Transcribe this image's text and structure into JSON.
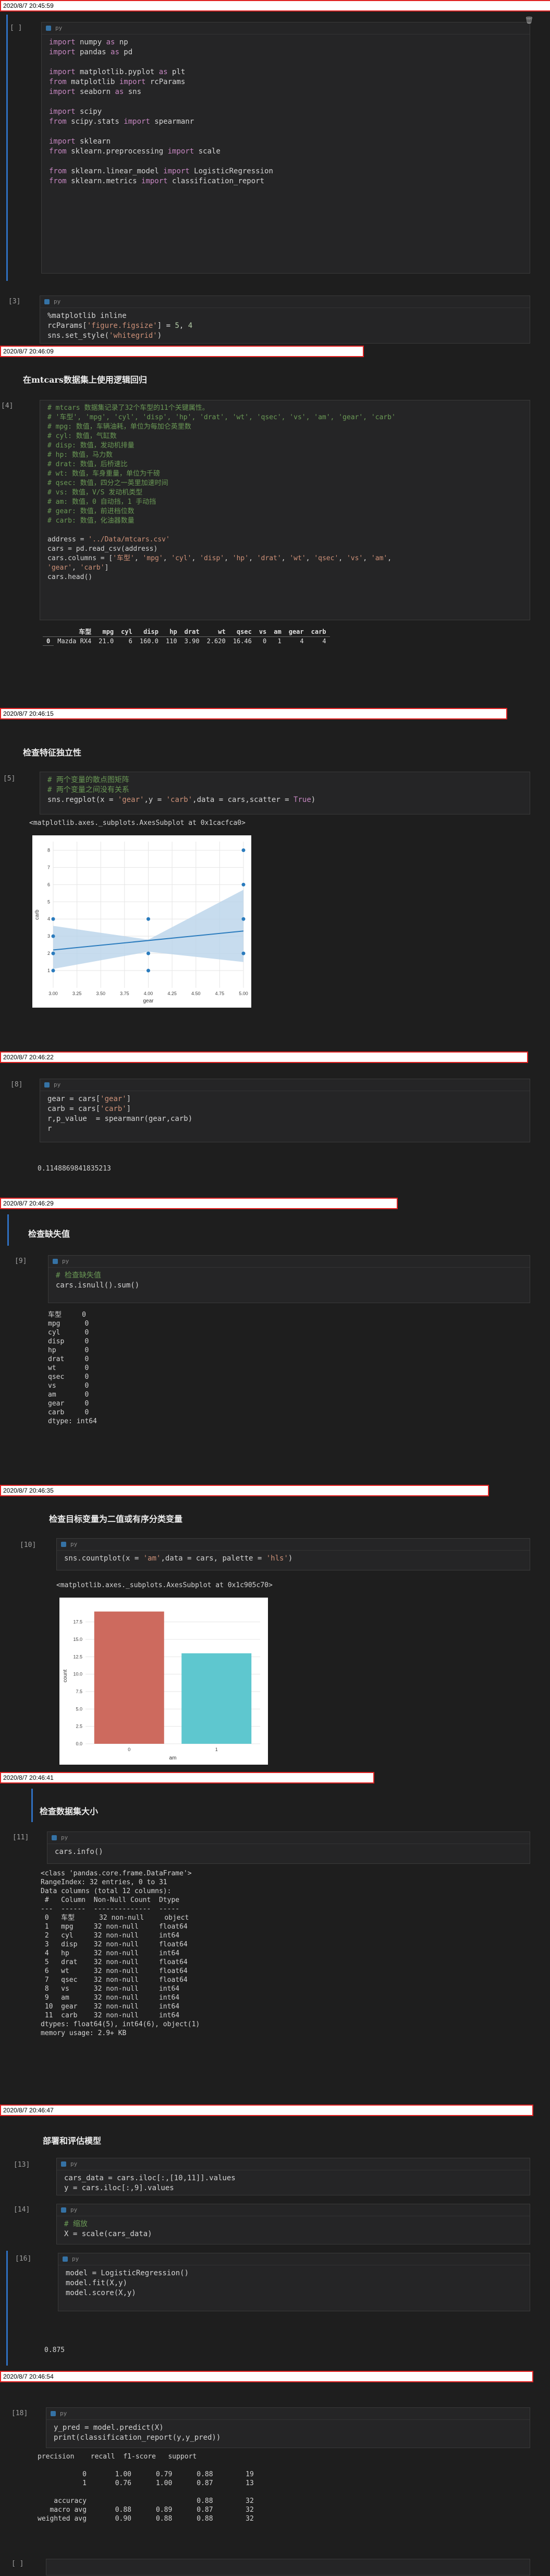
{
  "timestamps": [
    "2020/8/7 20:45:59",
    "2020/8/7 20:46:09",
    "2020/8/7 20:46:15",
    "2020/8/7 20:46:22",
    "2020/8/7 20:46:29",
    "2020/8/7 20:46:35",
    "2020/8/7 20:46:41",
    "2020/8/7 20:46:47",
    "2020/8/7 20:46:54"
  ],
  "editor_lang": "py",
  "cells": {
    "c1": {
      "prompt": "[ ]"
    },
    "c3": {
      "prompt": "[3]"
    },
    "c4": {
      "prompt": "[4]"
    },
    "c5": {
      "prompt": "[5]",
      "output": "<matplotlib.axes._subplots.AxesSubplot at 0x1cacfca0>"
    },
    "c8": {
      "prompt": "[8]",
      "output": "0.1148869841835213"
    },
    "c9": {
      "prompt": "[9]"
    },
    "c10": {
      "prompt": "[10]",
      "output": "<matplotlib.axes._subplots.AxesSubplot at 0x1c905c70>"
    },
    "c11": {
      "prompt": "[11]"
    },
    "c13": {
      "prompt": "[13]"
    },
    "c14": {
      "prompt": "[14]"
    },
    "c16": {
      "prompt": "[16]",
      "output": "0.875"
    },
    "c18": {
      "prompt": "[18]"
    },
    "c_empty": {
      "prompt": "[ ]"
    }
  },
  "headings": {
    "h1": "在mtcars数据集上使用逻辑回归",
    "h2": "检查特征独立性",
    "h3": "检查缺失值",
    "h4": "检查目标变量为二值或有序分类变量",
    "h5": "检查数据集大小",
    "h6": "部署和评估模型"
  },
  "head_table": {
    "columns": [
      "车型",
      "mpg",
      "cyl",
      "disp",
      "hp",
      "drat",
      "wt",
      "qsec",
      "vs",
      "am",
      "gear",
      "carb"
    ],
    "rows": [
      [
        "0",
        "Mazda RX4",
        "21.0",
        "6",
        "160.0",
        "110",
        "3.90",
        "2.620",
        "16.46",
        "0",
        "1",
        "4",
        "4"
      ]
    ]
  },
  "isnull_output": "车型     0\nmpg      0\ncyl      0\ndisp     0\nhp       0\ndrat     0\nwt       0\nqsec     0\nvs       0\nam       0\ngear     0\ncarb     0\ndtype: int64",
  "info_output": "<class 'pandas.core.frame.DataFrame'>\nRangeIndex: 32 entries, 0 to 31\nData columns (total 12 columns):\n #   Column  Non-Null Count  Dtype  \n---  ------  --------------  -----  \n 0   车型      32 non-null     object \n 1   mpg     32 non-null     float64\n 2   cyl     32 non-null     int64  \n 3   disp    32 non-null     float64\n 4   hp      32 non-null     int64  \n 5   drat    32 non-null     float64\n 6   wt      32 non-null     float64\n 7   qsec    32 non-null     float64\n 8   vs      32 non-null     int64  \n 9   am      32 non-null     int64  \n 10  gear    32 non-null     int64  \n 11  carb    32 non-null     int64  \ndtypes: float64(5), int64(6), object(1)\nmemory usage: 2.9+ KB",
  "report_output": "precision    recall  f1-score   support\n\n           0       1.00      0.79      0.88        19\n           1       0.76      1.00      0.87        13\n\n    accuracy                           0.88        32\n   macro avg       0.88      0.89      0.87        32\nweighted avg       0.90      0.88      0.88        32",
  "chart_data": [
    {
      "type": "scatter",
      "xlabel": "gear",
      "ylabel": "carb",
      "xlim": [
        3.0,
        5.0
      ],
      "ylim": [
        0,
        8.5
      ],
      "x_ticks": [
        "3.00",
        "3.25",
        "3.50",
        "3.75",
        "4.00",
        "4.25",
        "4.50",
        "4.75",
        "5.00"
      ],
      "y_ticks": [
        "8",
        "7",
        "6",
        "5",
        "4",
        "3",
        "2",
        "1"
      ],
      "points": [
        [
          3,
          1
        ],
        [
          3,
          2
        ],
        [
          3,
          3
        ],
        [
          3,
          4
        ],
        [
          4,
          1
        ],
        [
          4,
          2
        ],
        [
          4,
          4
        ],
        [
          5,
          2
        ],
        [
          5,
          4
        ],
        [
          5,
          6
        ],
        [
          5,
          8
        ]
      ],
      "fit_line": [
        [
          3,
          2.2
        ],
        [
          5,
          3.3
        ]
      ],
      "colors": {
        "points": "#2a7bbd",
        "line": "#2a7bbd",
        "band": "#b9d3ea"
      }
    },
    {
      "type": "bar",
      "categories": [
        "0",
        "1"
      ],
      "values": [
        19,
        13
      ],
      "xlabel": "am",
      "ylabel": "count",
      "ylim": [
        0,
        19.5
      ],
      "y_ticks": [
        "17.5",
        "15.0",
        "12.5",
        "10.0",
        "7.5",
        "5.0",
        "2.5",
        "0.0"
      ],
      "colors": [
        "#cd6a5e",
        "#5ec7cf"
      ]
    }
  ]
}
